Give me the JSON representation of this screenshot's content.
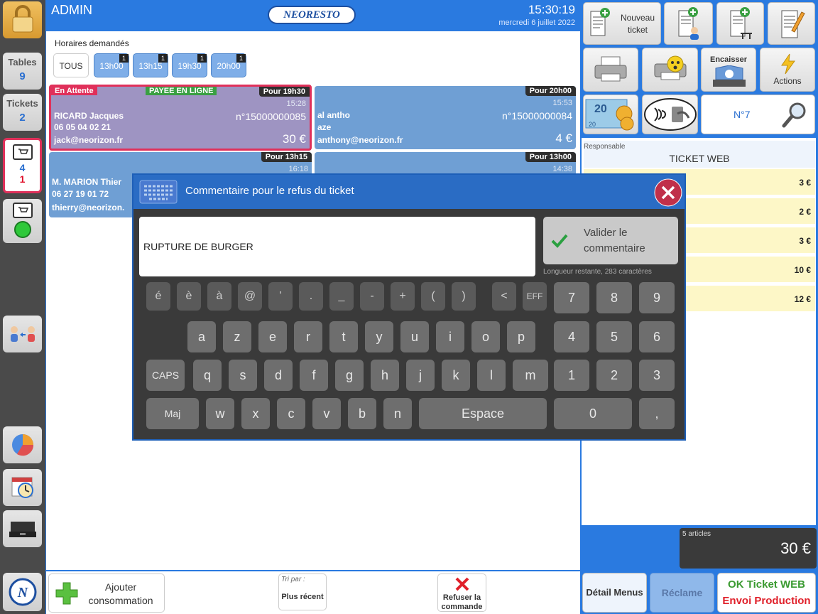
{
  "header": {
    "user": "ADMIN",
    "logo": "NEORESTO",
    "time": "15:30:19",
    "date": "mercredi 6 juillet 2022"
  },
  "sidebar": {
    "tables_label": "Tables",
    "tables_count": "9",
    "tickets_label": "Tickets",
    "tickets_count": "2",
    "web_orders_count": "4",
    "web_orders_alert": "1"
  },
  "horaires": {
    "label": "Horaires demandés",
    "all": "TOUS",
    "slots": [
      {
        "time": "13h00",
        "count": "1"
      },
      {
        "time": "13h15",
        "count": "1"
      },
      {
        "time": "19h30",
        "count": "1"
      },
      {
        "time": "20h00",
        "count": "1"
      }
    ]
  },
  "orders": [
    {
      "status": "En Attente",
      "payment": "PAYEE EN LIGNE",
      "pour": "Pour 19h30",
      "time": "15:28",
      "name": "RICARD Jacques",
      "number": "n°15000000085",
      "phone": "06 05 04 02 21",
      "email": "jack@neorizon.fr",
      "price": "30 €"
    },
    {
      "pour": "Pour 20h00",
      "time": "15:53",
      "name": "al antho",
      "number": "n°15000000084",
      "line2": "aze",
      "email": "anthony@neorizon.fr",
      "price": "4 €"
    },
    {
      "pour": "Pour 13h15",
      "time": "16:18",
      "name": "M. MARION Thier",
      "phone": "06 27 19 01 72",
      "email": "thierry@neorizon."
    },
    {
      "pour": "Pour 13h00",
      "time": "14:38"
    }
  ],
  "toolbar": {
    "new_ticket": "Nouveau ticket",
    "cash_in": "Encaisser",
    "actions": "Actions",
    "ticket_number": "N°7"
  },
  "ticket": {
    "responsible_label": "Responsable",
    "title": "TICKET WEB",
    "lines": [
      "3 €",
      "2 €",
      "3 €",
      "10 €",
      "12 €"
    ],
    "articles": "5 articles",
    "total": "30 €"
  },
  "right_buttons": {
    "detail_menus": "Détail Menus",
    "reclame": "Réclame",
    "ok_web": "OK Ticket WEB",
    "envoi": "Envoi Production"
  },
  "dialog": {
    "title": "Commentaire pour le refus du ticket",
    "comment": "RUPTURE DE BURGER",
    "validate": "Valider le commentaire",
    "remaining": "Longueur restante, 283 caractères"
  },
  "keyboard": {
    "row1": [
      "é",
      "è",
      "à",
      "@",
      "'",
      ".",
      "_",
      "-",
      "+",
      "(",
      ")",
      "<",
      "EFF"
    ],
    "row2": [
      "a",
      "z",
      "e",
      "r",
      "t",
      "y",
      "u",
      "i",
      "o",
      "p"
    ],
    "row3": [
      "CAPS",
      "q",
      "s",
      "d",
      "f",
      "g",
      "h",
      "j",
      "k",
      "l",
      "m"
    ],
    "row4": [
      "Maj",
      "w",
      "x",
      "c",
      "v",
      "b",
      "n",
      "Espace"
    ],
    "num1": [
      "7",
      "8",
      "9"
    ],
    "num2": [
      "4",
      "5",
      "6"
    ],
    "num3": [
      "1",
      "2",
      "3"
    ],
    "num4": [
      "0",
      ","
    ]
  },
  "bottom": {
    "add": "Ajouter consommation",
    "sort_label": "Tri par :",
    "sort_value": "Plus récent",
    "refuse": "Refuser la commande"
  }
}
